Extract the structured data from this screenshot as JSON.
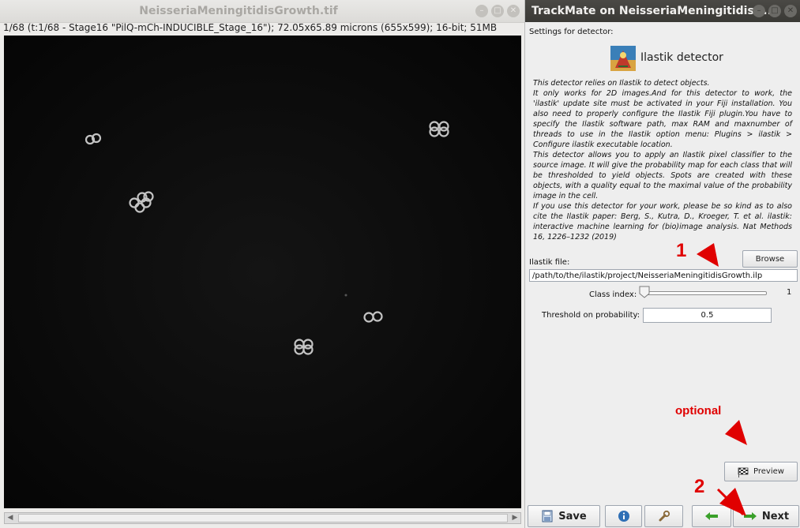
{
  "image_window": {
    "title": "NeisseriaMeningitidisGrowth.tif",
    "info": "1/68 (t:1/68 - Stage16 \"PilQ-mCh-INDUCIBLE_Stage_16\"); 72.05x65.89 microns (655x599); 16-bit; 51MB",
    "window_buttons": [
      "minimize-icon",
      "maximize-icon",
      "close-icon"
    ]
  },
  "trackmate": {
    "title": "TrackMate on NeisseriaMeningitidisG...",
    "settings_label": "Settings for detector:",
    "detector_name": "Ilastik detector",
    "description": [
      "This detector relies on Ilastik to detect objects.",
      "It only works for 2D images.And for this detector to work, the 'ilastik' update site must be activated in your Fiji installation. You also need to properly configure the Ilastik Fiji plugin.You have to specify the Ilastik software path, max RAM and maxnumber of threads to use in the Ilastik option menu: Plugins > ilastik > Configure ilastik executable location.",
      "This detector allows you to apply an Ilastik pixel classifier to the source image. It will give the probability map for each class that will be thresholded to yield objects. Spots are created with these objects, with a quality equal to the maximal value of the probability image in the cell.",
      "If you use this detector for your work, please be so kind as to also cite the Ilastik paper: Berg, S., Kutra, D., Kroeger, T. et al. ilastik: interactive machine learning for (bio)image analysis. Nat Methods 16, 1226–1232 (2019)"
    ],
    "ilastik_file_label": "Ilastik file:",
    "ilastik_file_value": "/path/to/the/ilastik/project/NeisseriaMeningitidisGrowth.ilp",
    "browse_label": "Browse",
    "class_index_label": "Class index:",
    "class_index_value": "1",
    "threshold_label": "Threshold on probability:",
    "threshold_value": "0.5",
    "preview_label": "Preview",
    "save_label": "Save",
    "next_label": "Next"
  },
  "annotations": {
    "step1": "1",
    "step2": "2",
    "optional": "optional"
  },
  "colors": {
    "annotation": "#e00000",
    "titlebar_dark": "#3a3935",
    "next_arrow": "#3aa02a"
  }
}
